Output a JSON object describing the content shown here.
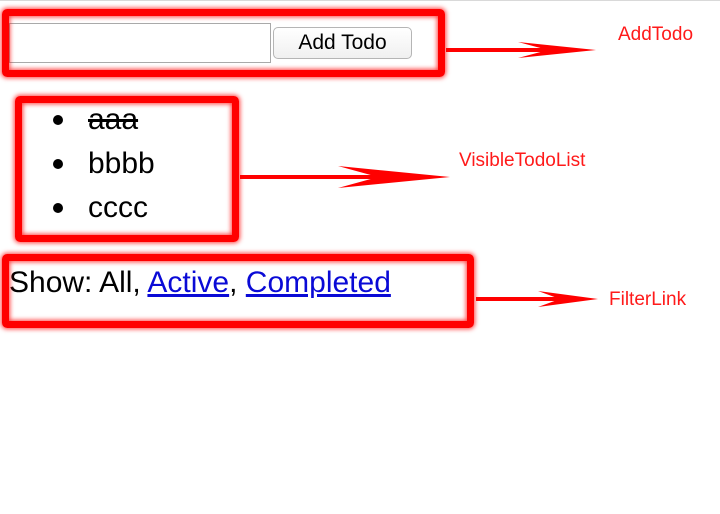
{
  "add_todo": {
    "input_value": "",
    "button_label": "Add Todo"
  },
  "todos": [
    {
      "text": "aaa",
      "completed": true
    },
    {
      "text": "bbbb",
      "completed": false
    },
    {
      "text": "cccc",
      "completed": false
    }
  ],
  "filter": {
    "prefix": "Show: ",
    "all_label": "All",
    "sep1": ", ",
    "active_label": "Active",
    "sep2": ", ",
    "completed_label": "Completed",
    "current": "All"
  },
  "annotations": {
    "add_todo_label": "AddTodo",
    "visible_todo_list_label": "VisibleTodoList",
    "filter_link_label": "FilterLink"
  },
  "colors": {
    "annotation_red": "#ff0000",
    "link_blue": "#0a0ad6"
  }
}
